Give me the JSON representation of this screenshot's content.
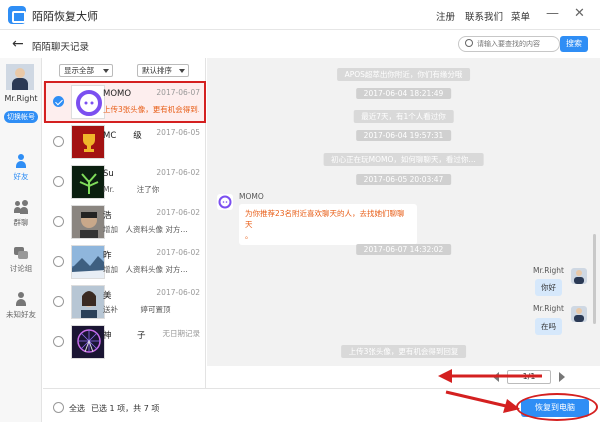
{
  "app": {
    "title": "陌陌恢复大师"
  },
  "topnav": {
    "register": "注册",
    "contact": "联系我们",
    "menu": "菜单"
  },
  "window": {
    "minimize": "—",
    "close": "✕"
  },
  "header": {
    "title": "陌陌聊天记录",
    "search_placeholder": "请输入要查找的内容",
    "search_button": "搜索"
  },
  "account": {
    "name": "Mr.Right",
    "switch": "切换帐号"
  },
  "rail": [
    {
      "label": "好友",
      "icon": "person-icon",
      "active": true
    },
    {
      "label": "群聊",
      "icon": "group-icon",
      "active": false
    },
    {
      "label": "讨论组",
      "icon": "chat-icon",
      "active": false
    },
    {
      "label": "未知好友",
      "icon": "unknown-person-icon",
      "active": false
    }
  ],
  "filters": {
    "show": "显示全部",
    "sort": "默认排序"
  },
  "contacts": [
    {
      "name": "MOMO",
      "date": "2017-06-07",
      "msg": "上传3张头像，更有机会得到…",
      "selected": true
    },
    {
      "name": "MC　　级",
      "date": "2017-06-05",
      "msg": "",
      "selected": false
    },
    {
      "name": "Su",
      "date": "2017-06-02",
      "msg": "Mr.　　　注了你",
      "selected": false
    },
    {
      "name": "浩",
      "date": "2017-06-02",
      "msg": "增加　人资料头像 对方…",
      "selected": false
    },
    {
      "name": "昨",
      "date": "2017-06-02",
      "msg": "增加　人资料头像 对方…",
      "selected": false
    },
    {
      "name": "美",
      "date": "2017-06-02",
      "msg": "送补　　　婷可置顶",
      "selected": false
    },
    {
      "name": "神　　　子",
      "date": "无日期记录",
      "msg": "",
      "selected": false
    }
  ],
  "chat": {
    "system": [
      "APOS超萃出你附近，你们有缘分哦",
      "2017-06-04 18:21:49",
      "最近7天，有1个人看过你",
      "2017-06-04 19:57:31",
      "初心正在玩MOMO，如何聊聊天，看过你…",
      "2017-06-05 20:03:47",
      "2017-06-07 14:32:02",
      "上传3张头像，更有机会得到回复"
    ],
    "incoming": {
      "name": "MOMO",
      "text1": "为你推荐23名附近喜欢聊天的人，去找她们聊聊天",
      "text2": "。"
    },
    "outgoing": [
      {
        "name": "Mr.Right",
        "text": "你好"
      },
      {
        "name": "Mr.Right",
        "text": "在吗"
      }
    ]
  },
  "pager": {
    "page": "1/1"
  },
  "footer": {
    "select_all": "全选",
    "status": "已选 1 项，共 7 项",
    "restore": "恢复到电脑"
  },
  "colors": {
    "accent": "#2f8ef5",
    "highlight": "#d42020",
    "system_msg": "#d9d9d9"
  }
}
